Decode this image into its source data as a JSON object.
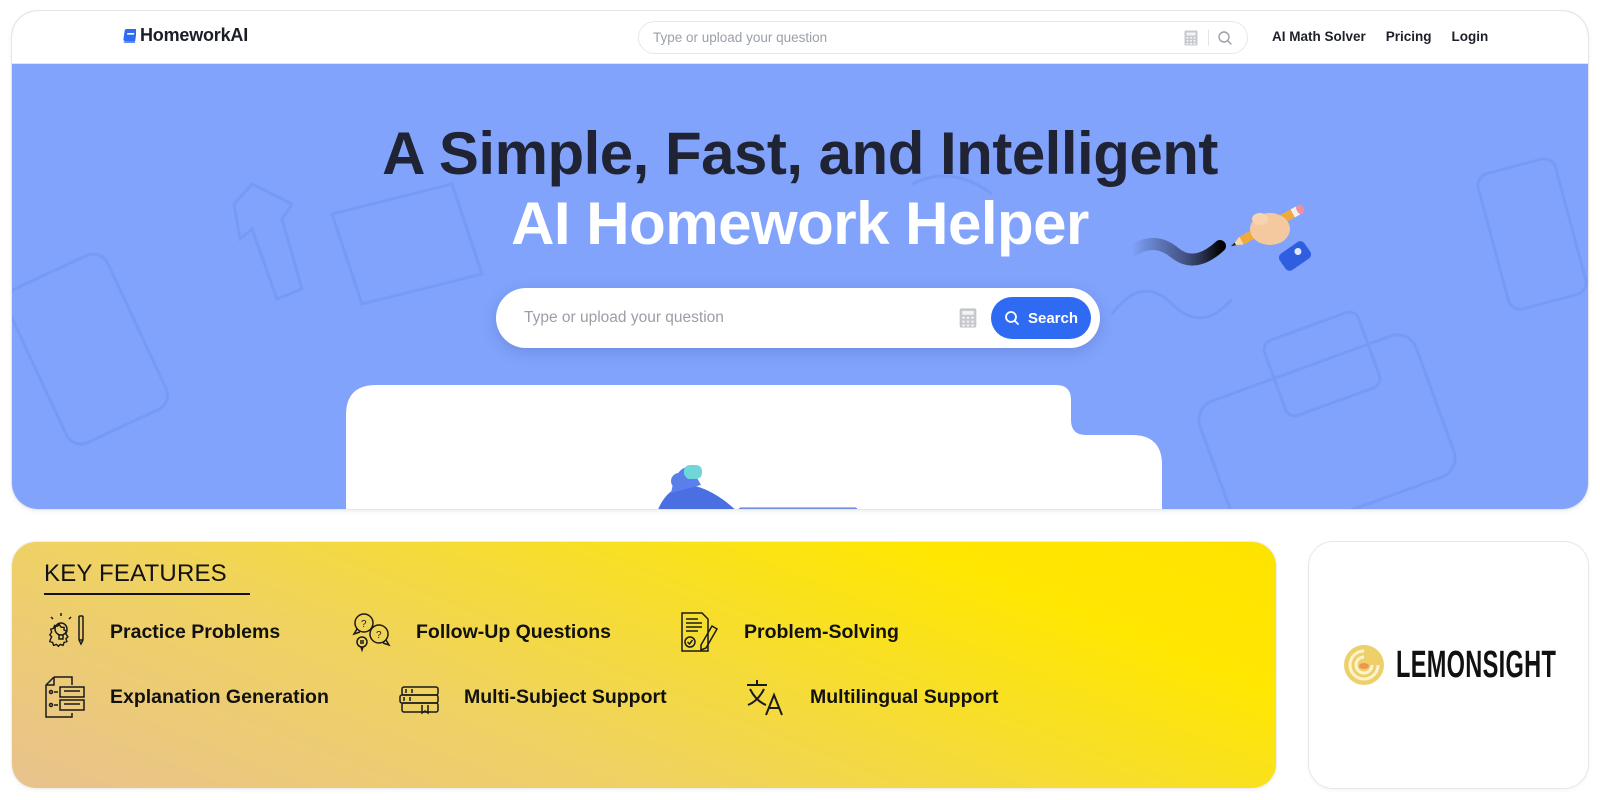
{
  "header": {
    "logo_text": "HomeworkAI",
    "search_placeholder": "Type or upload your question",
    "nav": [
      {
        "label": "AI Math Solver"
      },
      {
        "label": "Pricing"
      },
      {
        "label": "Login"
      }
    ]
  },
  "hero": {
    "title_line_1": "A Simple, Fast, and Intelligent",
    "title_line_2": "AI Homework Helper",
    "search_placeholder": "Type or upload your question",
    "search_button_label": "Search"
  },
  "features": {
    "title": "KEY FEATURES",
    "items": [
      {
        "label": "Practice Problems",
        "icon": "lightbulb-gear-icon"
      },
      {
        "label": "Follow-Up Questions",
        "icon": "question-bubbles-icon"
      },
      {
        "label": "Problem-Solving",
        "icon": "checklist-pencil-icon"
      },
      {
        "label": "Explanation Generation",
        "icon": "document-list-icon"
      },
      {
        "label": "Multi-Subject Support",
        "icon": "books-icon"
      },
      {
        "label": "Multilingual Support",
        "icon": "translate-icon"
      }
    ]
  },
  "sponsor": {
    "name": "LEMONSIGHT"
  },
  "colors": {
    "hero_bg": "#81a3fb",
    "accent_blue": "#2f6bf2",
    "features_yellow": "#ffe702"
  }
}
